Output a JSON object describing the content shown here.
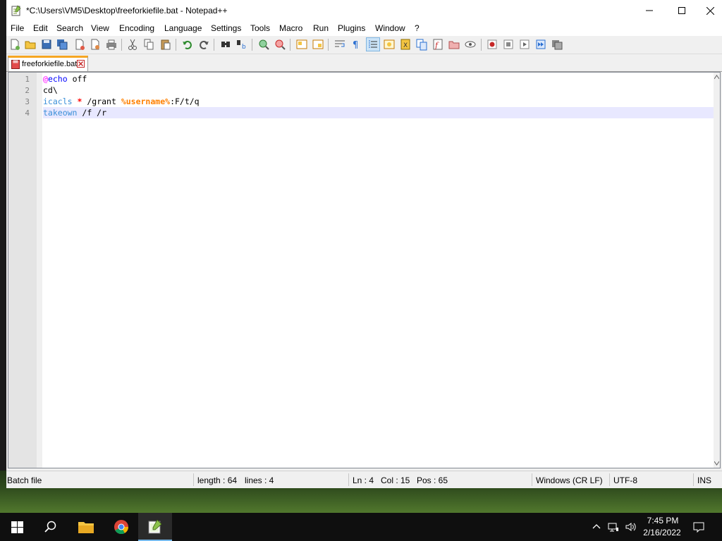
{
  "window": {
    "title": "*C:\\Users\\VM5\\Desktop\\freeforkiefile.bat - Notepad++"
  },
  "menu": [
    "File",
    "Edit",
    "Search",
    "View",
    "Encoding",
    "Language",
    "Settings",
    "Tools",
    "Macro",
    "Run",
    "Plugins",
    "Window",
    "?"
  ],
  "toolbar": {
    "icons": [
      "new-file-icon",
      "open-file-icon",
      "save-icon",
      "save-all-icon",
      "close-icon",
      "close-all-icon",
      "print-icon",
      "cut-icon",
      "copy-icon",
      "paste-icon",
      "undo-icon",
      "redo-icon",
      "find-icon",
      "replace-icon",
      "zoom-in-icon",
      "zoom-out-icon",
      "sync-vertical-icon",
      "sync-horizontal-icon",
      "word-wrap-icon",
      "show-all-chars-icon",
      "indent-guide-icon",
      "user-define-lang-icon",
      "doc-map-icon",
      "doc-list-icon",
      "function-list-icon",
      "folder-workspace-icon",
      "monitoring-icon",
      "record-macro-icon",
      "stop-record-icon",
      "play-macro-icon",
      "run-macro-multiple-icon",
      "save-macro-icon"
    ]
  },
  "tab": {
    "label": "freeforkiefile.bat"
  },
  "editor": {
    "line_numbers": [
      "1",
      "2",
      "3",
      "4"
    ],
    "lines": [
      [
        {
          "t": "@",
          "c": "kw-at"
        },
        {
          "t": "echo",
          "c": "kw"
        },
        {
          "t": " off",
          "c": "txt"
        }
      ],
      [
        {
          "t": "cd\\",
          "c": "txt"
        }
      ],
      [
        {
          "t": "icacls",
          "c": "kw-light"
        },
        {
          "t": " ",
          "c": "txt"
        },
        {
          "t": "*",
          "c": "op"
        },
        {
          "t": " /grant ",
          "c": "txt"
        },
        {
          "t": "%username%",
          "c": "var"
        },
        {
          "t": ":F/t/q",
          "c": "txt"
        }
      ],
      [
        {
          "t": "takeown",
          "c": "kw-light"
        },
        {
          "t": " /f /r",
          "c": "txt"
        }
      ]
    ],
    "current_line": 4
  },
  "status": {
    "language": "Batch file",
    "length": "length : 64",
    "lines": "lines : 4",
    "ln": "Ln : 4",
    "col": "Col : 15",
    "pos": "Pos : 65",
    "eol": "Windows (CR LF)",
    "encoding": "UTF-8",
    "mode": "INS"
  },
  "taskbar": {
    "time": "7:45 PM",
    "date": "2/16/2022"
  },
  "colors": {
    "accent_tab": "#f6a623",
    "current_line": "#e8e8ff",
    "keyword": "#0000ff",
    "variable": "#ff8000"
  }
}
